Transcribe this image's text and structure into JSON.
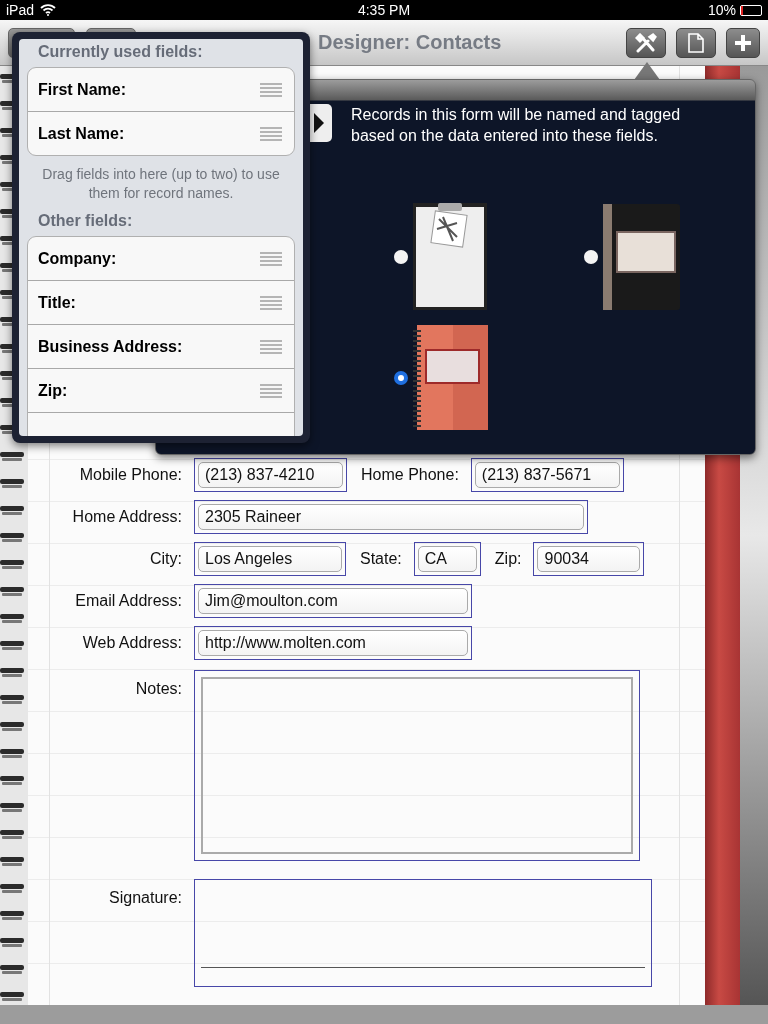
{
  "status_bar": {
    "device": "iPad",
    "time": "4:35 PM",
    "battery": "10%"
  },
  "nav_bar": {
    "title": "Designer: Contacts"
  },
  "fields_popover": {
    "used_heading": "Currently used fields:",
    "used_fields": [
      "First Name:",
      "Last Name:"
    ],
    "hint": "Drag fields into here (up to two) to use them for record names.",
    "other_heading": "Other fields:",
    "other_fields": [
      "Company:",
      "Title:",
      "Business Address:",
      "Zip:"
    ]
  },
  "style_popover": {
    "message": "Records in this form will be named and tagged based on the data entered into these fields.",
    "styles": [
      {
        "kind": "clipboard",
        "selected": false
      },
      {
        "kind": "ledger",
        "selected": false
      },
      {
        "kind": "spiral",
        "selected": true
      }
    ]
  },
  "form": {
    "rows": [
      {
        "fields": [
          {
            "label": "Mobile Phone:",
            "value": "(213) 837-4210",
            "kind": "phone"
          },
          {
            "label": "Home Phone:",
            "value": "(213) 837-5671",
            "kind": "phone"
          }
        ]
      },
      {
        "fields": [
          {
            "label": "Home Address:",
            "value": "2305 Raineer",
            "kind": "address"
          }
        ]
      },
      {
        "fields": [
          {
            "label": "City:",
            "value": "Los Angeles",
            "kind": "city"
          },
          {
            "label": "State:",
            "value": "CA",
            "kind": "state"
          },
          {
            "label": "Zip:",
            "value": "90034",
            "kind": "zip"
          }
        ]
      },
      {
        "fields": [
          {
            "label": "Email Address:",
            "value": "Jim@moulton.com",
            "kind": "email"
          }
        ]
      },
      {
        "fields": [
          {
            "label": "Web Address:",
            "value": "http://www.molten.com",
            "kind": "web"
          }
        ]
      },
      {
        "fields": [
          {
            "label": "Notes:",
            "kind": "notes"
          }
        ]
      },
      {
        "fields": [
          {
            "label": "Signature:",
            "kind": "signature"
          }
        ]
      }
    ]
  }
}
